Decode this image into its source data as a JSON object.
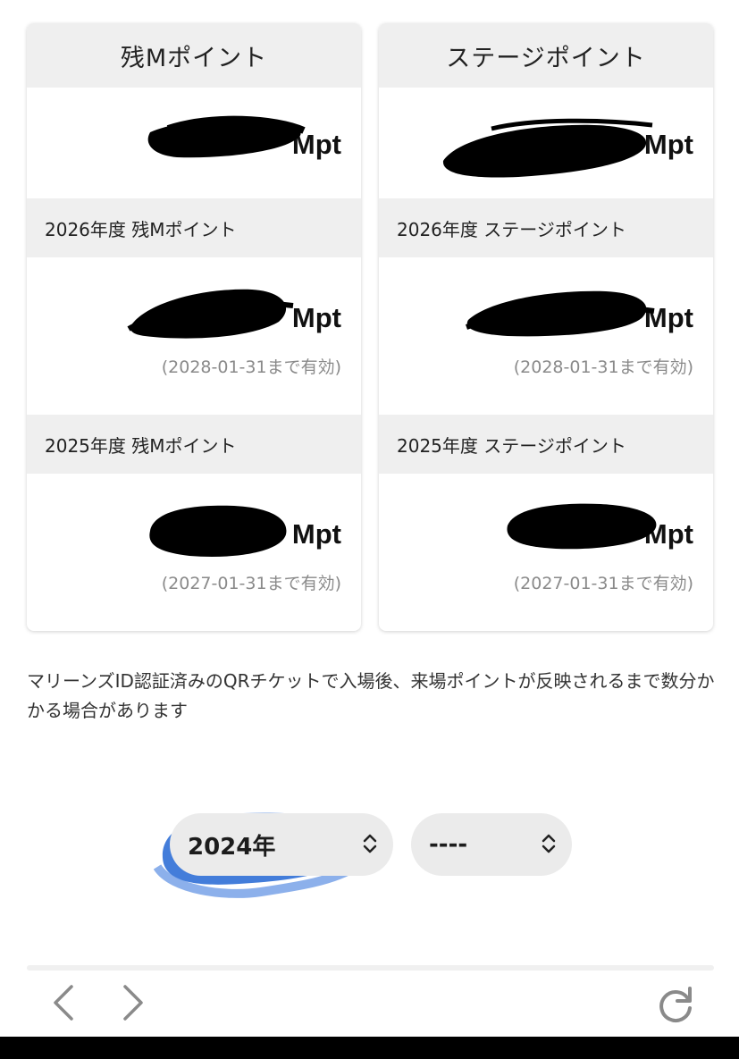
{
  "cards": [
    {
      "title": "残Mポイント",
      "total_unit": "Mpt",
      "sections": [
        {
          "label": "2026年度 残Mポイント",
          "unit": "Mpt",
          "expiry": "(2028-01-31まで有効)"
        },
        {
          "label": "2025年度 残Mポイント",
          "unit": "Mpt",
          "expiry": "(2027-01-31まで有効)"
        }
      ]
    },
    {
      "title": "ステージポイント",
      "total_unit": "Mpt",
      "sections": [
        {
          "label": "2026年度 ステージポイント",
          "unit": "Mpt",
          "expiry": "(2028-01-31まで有効)"
        },
        {
          "label": "2025年度 ステージポイント",
          "unit": "Mpt",
          "expiry": "(2027-01-31まで有効)"
        }
      ]
    }
  ],
  "notice": "マリーンズID認証済みのQRチケットで入場後、来場ポイントが反映されるまで数分かかる場合があります",
  "filters": {
    "year_value": "2024年",
    "month_value": "----"
  },
  "toolbar": {
    "back_icon": "chevron-left-icon",
    "forward_icon": "chevron-right-icon",
    "reload_icon": "reload-icon"
  },
  "colors": {
    "header_bg": "#efefef",
    "expiry_text": "#8a8a8a",
    "select_bg": "#ebebeb",
    "highlight_blue": "#2f6fd6"
  }
}
